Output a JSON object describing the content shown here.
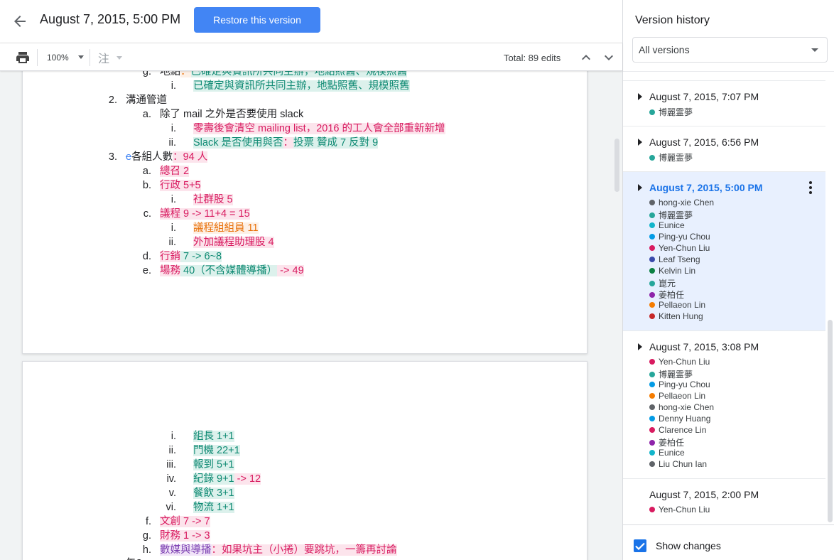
{
  "header": {
    "title": "August 7, 2015, 5:00 PM",
    "restore_label": "Restore this version"
  },
  "toolbar": {
    "zoom": "100%",
    "style_placeholder": "注",
    "total_edits": "Total: 89 edits"
  },
  "doc": {
    "p1": {
      "g_marker": "g.",
      "g_plain": "地點",
      "g_colon": "：",
      "g_text": "已確定與資訊所共同主辦，地點照舊、規模照舊",
      "g_i_marker": "i.",
      "g_i_text": "已確定與資訊所共同主辦，地點照舊、規模照舊",
      "n2_marker": "2.",
      "n2_text": "溝通管道",
      "a_marker": "a.",
      "a_text": "除了 mail 之外是否要使用 slack",
      "a_i_marker": "i.",
      "a_i_text": "零壽後會清空 mailing list，2016 的工人會全部重新新增",
      "a_ii_marker": "ii.",
      "a_ii_text1": "Slack 是否使用與否",
      "a_ii_colon": "：",
      "a_ii_text2": "投票 贊成 7 反對 9",
      "n3_marker": "3.",
      "n3_strike": "e",
      "n3_text": "各組人數",
      "n3_ins": "：94 人",
      "b3a_marker": "a.",
      "b3a_text": "總召 2",
      "b3b_marker": "b.",
      "b3b_text": "行政 5+5",
      "b3b_i_marker": "i.",
      "b3b_i_text": "社群股 5",
      "b3c_marker": "c.",
      "b3c_text": "議程 9 -> 11+4 = 15",
      "b3c_i_marker": "i.",
      "b3c_i_text": "議程組組員 11",
      "b3c_ii_marker": "ii.",
      "b3c_ii_text": "外加議程助理股 4",
      "b3d_marker": "d.",
      "b3d_t1": "行銷",
      "b3d_t2": " 7 -> 6~8",
      "b3e_marker": "e.",
      "b3e_t1": "場務",
      "b3e_t2": " 40（不含媒體導播）",
      "b3e_t3": " -> 49"
    },
    "p2": {
      "i_marker": "i.",
      "i_text": "組長 1+1",
      "ii_marker": "ii.",
      "ii_text": "門機 22+1",
      "iii_marker": "iii.",
      "iii_text": "報到 5+1",
      "iv_marker": "iv.",
      "iv_text1": "紀錄 9+1",
      "iv_text2": " -> 12",
      "v_marker": "v.",
      "v_text": "餐飲 3+1",
      "vi_marker": "vi.",
      "vi_text": "物流 1+1",
      "f_marker": "f.",
      "f_text": "文創 7 -> 7",
      "g_marker": "g.",
      "g_text": "財務 1 -> 3",
      "h_marker": "h.",
      "h_t1": "數媒與導播",
      "h_t2": "：如果坑主（小捲）要跳坑，一籌再討論",
      "bottom_text": "午?"
    }
  },
  "side": {
    "title": "Version history",
    "filter": "All versions",
    "versions": [
      {
        "date": "August 7, 2015, 7:07 PM",
        "authors": [
          {
            "name": "博麗霊夢",
            "color": "#26a69a"
          }
        ]
      },
      {
        "date": "August 7, 2015, 6:56 PM",
        "authors": [
          {
            "name": "博麗霊夢",
            "color": "#26a69a"
          }
        ]
      },
      {
        "date": "August 7, 2015, 5:00 PM",
        "authors": [
          {
            "name": "hong-xie Chen",
            "color": "#5f6368"
          },
          {
            "name": "博麗霊夢",
            "color": "#26a69a"
          },
          {
            "name": "Eunice",
            "color": "#12b5cb"
          },
          {
            "name": "Ping-yu Chou",
            "color": "#039be5"
          },
          {
            "name": "Yen-Chun Liu",
            "color": "#d81b60"
          },
          {
            "name": "Leaf Tseng",
            "color": "#3949ab"
          },
          {
            "name": "Kelvin Lin",
            "color": "#0b8043"
          },
          {
            "name": "崑元",
            "color": "#26a69a"
          },
          {
            "name": "姜柏任",
            "color": "#8e24aa"
          },
          {
            "name": "Pellaeon Lin",
            "color": "#f57c00"
          },
          {
            "name": "Kitten Hung",
            "color": "#c62828"
          }
        ]
      },
      {
        "date": "August 7, 2015, 3:08 PM",
        "authors": [
          {
            "name": "Yen-Chun Liu",
            "color": "#d81b60"
          },
          {
            "name": "博麗霊夢",
            "color": "#26a69a"
          },
          {
            "name": "Ping-yu Chou",
            "color": "#039be5"
          },
          {
            "name": "Pellaeon Lin",
            "color": "#f57c00"
          },
          {
            "name": "hong-xie Chen",
            "color": "#5f6368"
          },
          {
            "name": "Denny Huang",
            "color": "#039be5"
          },
          {
            "name": "Clarence Lin",
            "color": "#d81b60"
          },
          {
            "name": "姜柏任",
            "color": "#8e24aa"
          },
          {
            "name": "Eunice",
            "color": "#12b5cb"
          },
          {
            "name": "Liu Chun Ian",
            "color": "#5f6368"
          }
        ]
      },
      {
        "date": "August 7, 2015, 2:00 PM",
        "authors": [
          {
            "name": "Yen-Chun Liu",
            "color": "#d81b60"
          }
        ]
      }
    ],
    "show_changes_label": "Show changes"
  }
}
